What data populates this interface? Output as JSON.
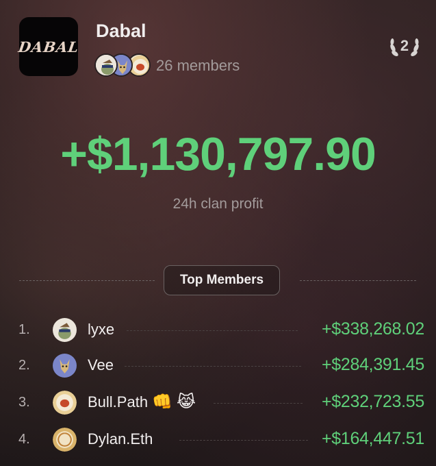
{
  "clan": {
    "logo_text": "DABAL",
    "name": "Dabal",
    "members_label": "26 members",
    "rank": "2"
  },
  "profit": {
    "value": "+$1,130,797.90",
    "label": "24h clan profit"
  },
  "top_members": {
    "title": "Top Members",
    "items": [
      {
        "rank": "1.",
        "name": "lyxe",
        "amount": "+$338,268.02",
        "emoji": [],
        "avatar_icon": "frog-avatar-icon"
      },
      {
        "rank": "2.",
        "name": "Vee",
        "amount": "+$284,391.45",
        "emoji": [],
        "avatar_icon": "fox-avatar-icon"
      },
      {
        "rank": "3.",
        "name": "Bull.Path",
        "amount": "+$232,723.55",
        "emoji": [
          "👊",
          "😹"
        ],
        "avatar_icon": "bull-avatar-icon"
      },
      {
        "rank": "4.",
        "name": "Dylan.Eth",
        "amount": "+$164,447.51",
        "emoji": [],
        "avatar_icon": "coin-avatar-icon"
      }
    ]
  },
  "colors": {
    "profit_green": "#5fd07a",
    "muted_text": "#a39b9b",
    "logo_bg": "#060506"
  }
}
